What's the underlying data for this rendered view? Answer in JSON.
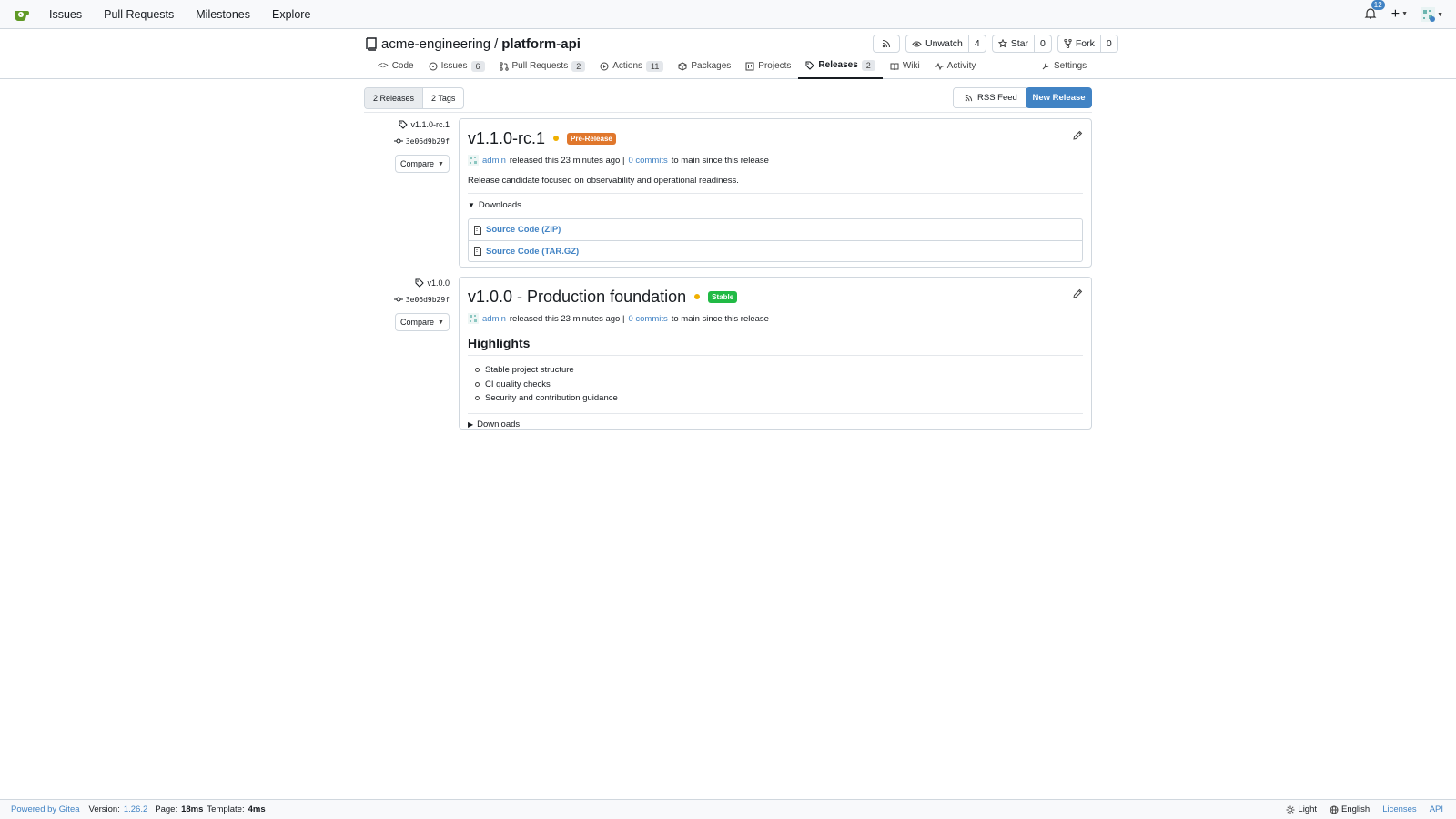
{
  "topnav": {
    "items": [
      "Issues",
      "Pull Requests",
      "Milestones",
      "Explore"
    ],
    "notifications_count": "12"
  },
  "repo": {
    "owner": "acme-engineering",
    "separator": "/",
    "name": "platform-api",
    "watch_label": "Unwatch",
    "watch_count": "4",
    "star_label": "Star",
    "star_count": "0",
    "fork_label": "Fork",
    "fork_count": "0"
  },
  "tabs": [
    {
      "label": "Code",
      "count": null,
      "icon": "code-icon"
    },
    {
      "label": "Issues",
      "count": "6",
      "icon": "issue-icon"
    },
    {
      "label": "Pull Requests",
      "count": "2",
      "icon": "pull-request-icon"
    },
    {
      "label": "Actions",
      "count": "11",
      "icon": "play-circle-icon"
    },
    {
      "label": "Packages",
      "count": null,
      "icon": "package-icon"
    },
    {
      "label": "Projects",
      "count": null,
      "icon": "project-board-icon"
    },
    {
      "label": "Releases",
      "count": "2",
      "icon": "tag-icon",
      "active": true
    },
    {
      "label": "Wiki",
      "count": null,
      "icon": "book-icon"
    },
    {
      "label": "Activity",
      "count": null,
      "icon": "pulse-icon"
    }
  ],
  "settings_label": "Settings",
  "toolbar": {
    "releases_label": "2 Releases",
    "tags_label": "2 Tags",
    "rss_label": "RSS Feed",
    "new_release_label": "New Release"
  },
  "releases": [
    {
      "tag": "v1.1.0-rc.1",
      "commit": "3e06d9b29f",
      "compare_label": "Compare",
      "title": "v1.1.0-rc.1",
      "badge": "Pre-Release",
      "author": "admin",
      "released_text": "released this 23 minutes ago |",
      "commits_link": "0 commits",
      "since_text": "to main since this release",
      "description": "Release candidate focused on observability and operational readiness.",
      "downloads_label": "Downloads",
      "downloads": [
        "Source Code (ZIP)",
        "Source Code (TAR.GZ)"
      ]
    },
    {
      "tag": "v1.0.0",
      "commit": "3e06d9b29f",
      "compare_label": "Compare",
      "title": "v1.0.0 - Production foundation",
      "badge": "Stable",
      "author": "admin",
      "released_text": "released this 23 minutes ago |",
      "commits_link": "0 commits",
      "since_text": "to main since this release",
      "highlights_heading": "Highlights",
      "highlights": [
        "Stable project structure",
        "CI quality checks",
        "Security and contribution guidance"
      ],
      "downloads_label": "Downloads"
    }
  ],
  "footer": {
    "powered": "Powered by Gitea",
    "version_label": "Version:",
    "version": "1.26.2",
    "page_label": "Page:",
    "page_time": "18ms",
    "template_label": "Template:",
    "template_time": "4ms",
    "theme": "Light",
    "language": "English",
    "licenses": "Licenses",
    "api": "API"
  },
  "colors": {
    "accent": "#4183c4",
    "prerelease": "#e0772c",
    "stable": "#21ba45",
    "dot": "#f0b000"
  }
}
